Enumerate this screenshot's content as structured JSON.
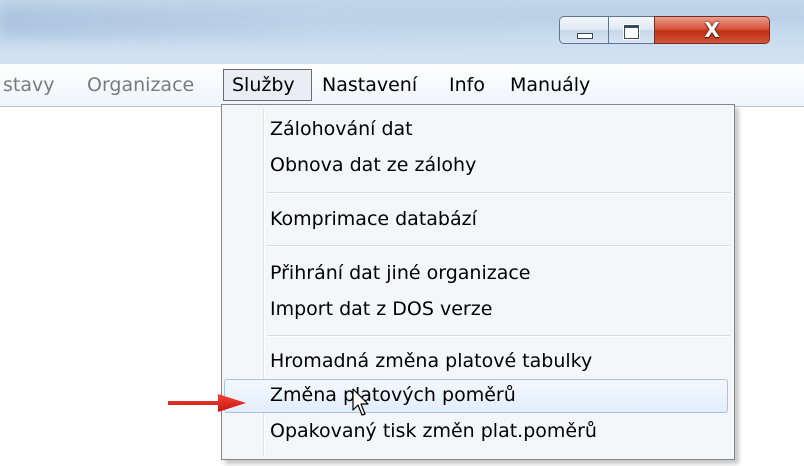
{
  "window": {
    "controls": {
      "minimize_icon": "minimize-icon",
      "maximize_icon": "maximize-icon",
      "close_icon": "close-icon",
      "close_glyph": "X",
      "close_color": "#c8371c"
    }
  },
  "menubar": {
    "items": [
      {
        "label": "stavy",
        "state": "disabled"
      },
      {
        "label": "Organizace",
        "state": "disabled"
      },
      {
        "label": "Služby",
        "state": "open"
      },
      {
        "label": "Nastavení",
        "state": "enabled"
      },
      {
        "label": "Info",
        "state": "enabled"
      },
      {
        "label": "Manuály",
        "state": "enabled"
      }
    ]
  },
  "dropdown": {
    "groups": [
      [
        "Zálohování dat",
        "Obnova dat ze zálohy"
      ],
      [
        "Komprimace databází"
      ],
      [
        "Přihrání dat jiné organizace",
        "Import dat z DOS verze"
      ],
      [
        "Hromadná změna platové tabulky",
        "Změna platových poměrů",
        "Opakovaný tisk změn plat.poměrů"
      ]
    ],
    "items": [
      {
        "label": "Zálohování dat"
      },
      {
        "label": "Obnova dat ze zálohy"
      },
      {
        "label": "Komprimace databází"
      },
      {
        "label": "Přihrání dat jiné organizace"
      },
      {
        "label": "Import dat z DOS verze"
      },
      {
        "label": "Hromadná změna platové tabulky"
      },
      {
        "label": "Změna platových poměrů",
        "highlighted": true
      },
      {
        "label": "Opakovaný tisk změn plat.poměrů"
      }
    ]
  },
  "annotation": {
    "arrow_icon": "red-arrow-icon",
    "arrow_color": "#e0201c",
    "points_to": "Změna platových poměrů"
  },
  "cursor": {
    "icon": "mouse-pointer-icon"
  }
}
